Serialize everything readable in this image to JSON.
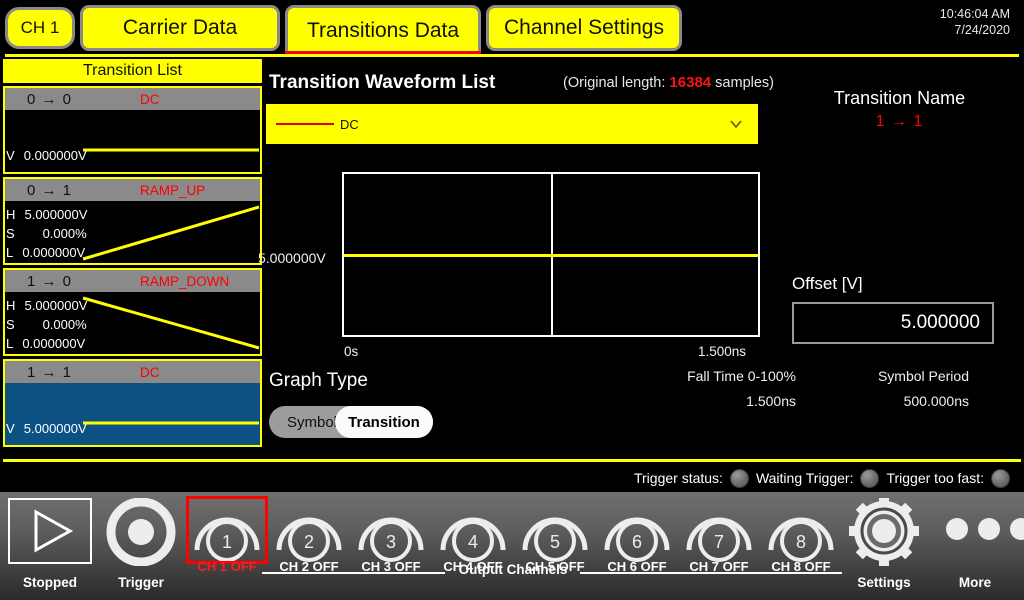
{
  "header": {
    "channel_chip": "CH 1",
    "tabs": [
      {
        "label": "Carrier Data",
        "active": false
      },
      {
        "label": "Transitions Data",
        "active": true
      },
      {
        "label": "Channel Settings",
        "active": false
      }
    ],
    "clock_time": "10:46:04 AM",
    "clock_date": "7/24/2020"
  },
  "transition_list": {
    "title": "Transition List",
    "items": [
      {
        "transition": "0 → 0",
        "kind": "DC",
        "selected": false,
        "shape": "flat-low",
        "fields": [
          {
            "key": "V",
            "value": "0.000000V"
          }
        ]
      },
      {
        "transition": "0 → 1",
        "kind": "RAMP_UP",
        "selected": false,
        "shape": "ramp-up",
        "fields": [
          {
            "key": "H",
            "value": "5.000000V"
          },
          {
            "key": "S",
            "value": "0.000%"
          },
          {
            "key": "L",
            "value": "0.000000V"
          }
        ]
      },
      {
        "transition": "1 → 0",
        "kind": "RAMP_DOWN",
        "selected": false,
        "shape": "ramp-down",
        "fields": [
          {
            "key": "H",
            "value": "5.000000V"
          },
          {
            "key": "S",
            "value": "0.000%"
          },
          {
            "key": "L",
            "value": "0.000000V"
          }
        ]
      },
      {
        "transition": "1 → 1",
        "kind": "DC",
        "selected": true,
        "shape": "flat-high",
        "fields": [
          {
            "key": "V",
            "value": "5.000000V"
          }
        ]
      }
    ]
  },
  "main": {
    "title": "Transition Waveform List",
    "original_length_prefix": "(Original length:",
    "original_length_value": "16384",
    "original_length_suffix": "samples)",
    "waveform_selected": "DC",
    "graph_type_label": "Graph Type",
    "toggle": {
      "option_off": "Symbol",
      "option_on": "Transition",
      "selected": "Transition"
    },
    "metrics": [
      {
        "label": "Fall Time 0-100%",
        "value": "1.500ns"
      },
      {
        "label": "Symbol Period",
        "value": "500.000ns"
      }
    ]
  },
  "chart_data": {
    "type": "line",
    "title": "",
    "xlabel": "",
    "ylabel": "",
    "y_tick_label": "5.000000V",
    "x_tick_labels": [
      "0s",
      "1.500ns"
    ],
    "xlim": [
      0,
      1.5
    ],
    "ylim": [
      0,
      10
    ],
    "grid": true,
    "series": [
      {
        "name": "DC",
        "color": "#ffff00",
        "x": [
          0,
          0.75,
          1.5
        ],
        "y": [
          5.0,
          5.0,
          5.0
        ]
      }
    ]
  },
  "right_panel": {
    "transition_name_label": "Transition Name",
    "transition_name_value": "1 → 1",
    "offset_label": "Offset [V]",
    "offset_value": "5.000000"
  },
  "status": {
    "trigger_status_label": "Trigger status:",
    "waiting_trigger_label": "Waiting Trigger:",
    "trigger_too_fast_label": "Trigger too fast:"
  },
  "toolbar": {
    "run_label": "Stopped",
    "trigger_label": "Trigger",
    "output_channels_label": "Output Channels",
    "settings_label": "Settings",
    "more_label": "More",
    "channels": [
      {
        "number": "1",
        "label": "CH 1 OFF",
        "selected": true
      },
      {
        "number": "2",
        "label": "CH 2 OFF",
        "selected": false
      },
      {
        "number": "3",
        "label": "CH 3 OFF",
        "selected": false
      },
      {
        "number": "4",
        "label": "CH 4 OFF",
        "selected": false
      },
      {
        "number": "5",
        "label": "CH 5 OFF",
        "selected": false
      },
      {
        "number": "6",
        "label": "CH 6 OFF",
        "selected": false
      },
      {
        "number": "7",
        "label": "CH 7 OFF",
        "selected": false
      },
      {
        "number": "8",
        "label": "CH 8 OFF",
        "selected": false
      }
    ]
  },
  "colors": {
    "accent_yellow": "#ffff00",
    "alert_red": "#ff0000",
    "selection_blue": "#0b5183",
    "panel_black": "#000000"
  }
}
